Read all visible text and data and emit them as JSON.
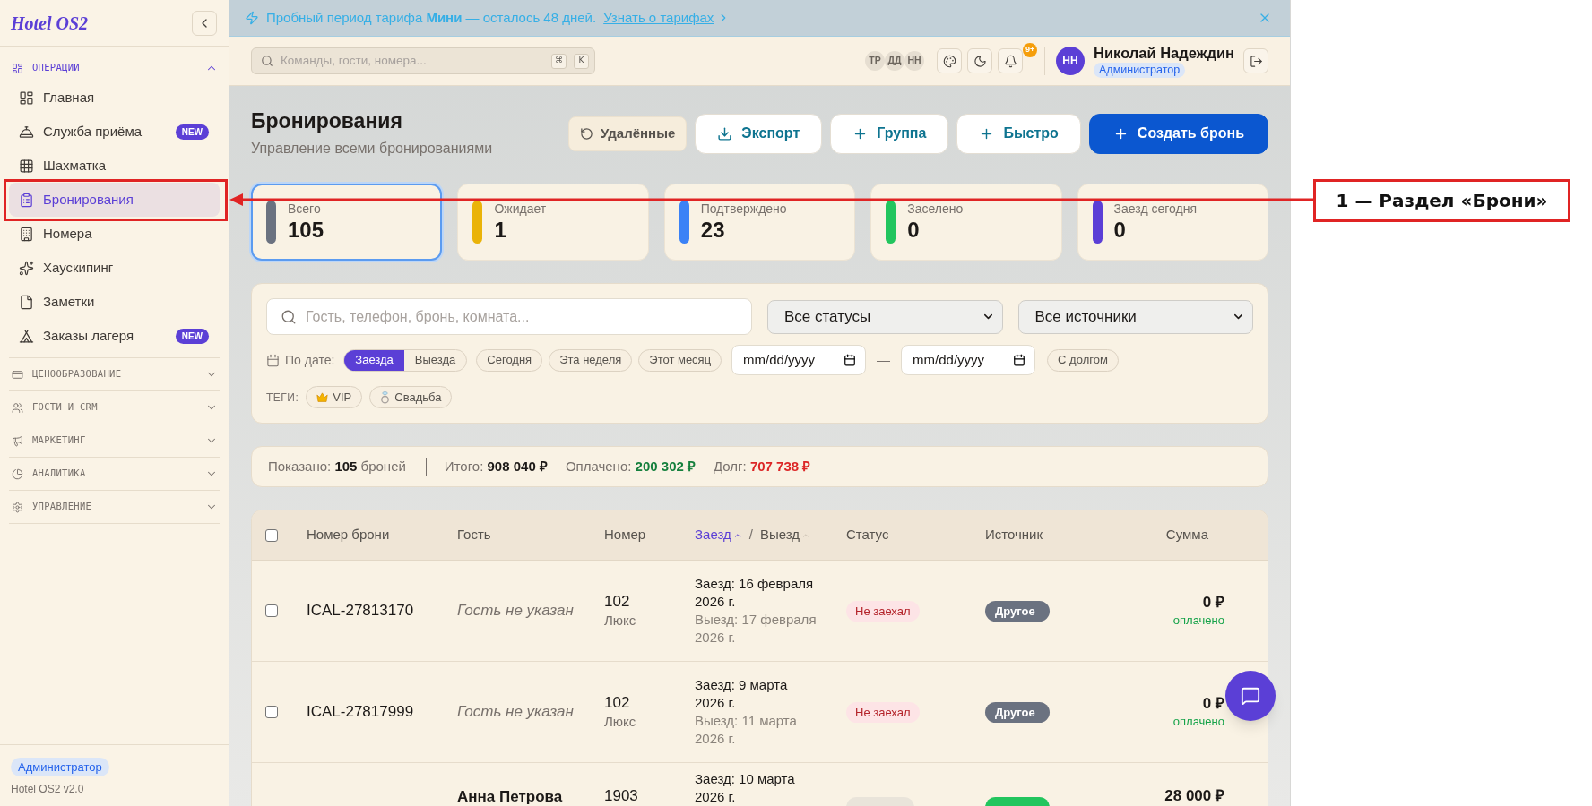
{
  "sidebar": {
    "logo": "Hotel OS2",
    "sections": [
      {
        "title": "ОПЕРАЦИИ",
        "expanded": true,
        "items": [
          {
            "label": "Главная",
            "selected": false
          },
          {
            "label": "Служба приёма",
            "selected": false,
            "badge": "NEW"
          },
          {
            "label": "Шахматка",
            "selected": false
          },
          {
            "label": "Бронирования",
            "selected": true
          },
          {
            "label": "Номера",
            "selected": false
          },
          {
            "label": "Хаускипинг",
            "selected": false
          },
          {
            "label": "Заметки",
            "selected": false
          },
          {
            "label": "Заказы лагеря",
            "selected": false,
            "badge": "NEW"
          }
        ]
      },
      {
        "title": "ЦЕНООБРАЗОВАНИЕ",
        "expanded": false
      },
      {
        "title": "ГОСТИ И CRM",
        "expanded": false
      },
      {
        "title": "МАРКЕТИНГ",
        "expanded": false
      },
      {
        "title": "АНАЛИТИКА",
        "expanded": false
      },
      {
        "title": "УПРАВЛЕНИЕ",
        "expanded": false
      }
    ],
    "footer": {
      "role": "Администратор",
      "version": "Hotel OS2 v2.0"
    }
  },
  "banner": {
    "text": "Пробный период тарифа **Мини** — осталось 48 дней.",
    "link": "Узнать о тарифах"
  },
  "topbar": {
    "search": {
      "placeholder": "Команды, гости, номера...",
      "keys": [
        "⌘",
        "K"
      ]
    },
    "presence": [
      "ТР",
      "ДД",
      "НН"
    ],
    "notifications": "9+",
    "user": {
      "initials": "НН",
      "name": "Николай Надеждин",
      "role": "Администратор"
    }
  },
  "page": {
    "title": "Бронирования",
    "subtitle": "Управление всеми бронированиями",
    "actions": [
      {
        "label": "Удалённые",
        "kind": "muted"
      },
      {
        "label": "Экспорт",
        "kind": "outline"
      },
      {
        "label": "Группа",
        "kind": "outline"
      },
      {
        "label": "Быстро",
        "kind": "outline"
      },
      {
        "label": "Создать бронь",
        "kind": "primary"
      }
    ]
  },
  "stats": [
    {
      "label": "Всего",
      "value": "105",
      "color": "#6b7280",
      "selected": true
    },
    {
      "label": "Ожидает",
      "value": "1",
      "color": "#eab308",
      "selected": false
    },
    {
      "label": "Подтверждено",
      "value": "23",
      "color": "#3b82f6",
      "selected": false
    },
    {
      "label": "Заселено",
      "value": "0",
      "color": "#22c55e",
      "selected": false
    },
    {
      "label": "Заезд сегодня",
      "value": "0",
      "color": "#5b3fd6",
      "selected": false
    }
  ],
  "filters": {
    "search": {
      "placeholder": "Гость, телефон, бронь, комната..."
    },
    "selects": [
      "Все статусы",
      "Все источники"
    ],
    "date_label": "По дате:",
    "date_modes": [
      {
        "label": "Заезда",
        "selected": true
      },
      {
        "label": "Выезда",
        "selected": false
      }
    ],
    "presets": [
      {
        "label": "Сегодня",
        "selected": false
      },
      {
        "label": "Эта неделя",
        "selected": false
      },
      {
        "label": "Этот месяц",
        "selected": false
      }
    ],
    "date_from": {
      "placeholder": "mm/dd/yyyy"
    },
    "date_separator": "—",
    "date_to": {
      "placeholder": "mm/dd/yyyy"
    },
    "debt_filter": {
      "label": "С долгом",
      "selected": false
    },
    "tags_label": "ТЕГИ:",
    "tags": [
      {
        "label": "VIP",
        "selected": false
      },
      {
        "label": "Свадьба",
        "selected": false
      }
    ]
  },
  "summary": [
    {
      "label": "Показано:",
      "value": "105",
      "suffix": "броней",
      "kind": "count"
    },
    {
      "label": "Итого:",
      "value": "908 040 ₽",
      "kind": "total"
    },
    {
      "label": "Оплачено:",
      "value": "200 302 ₽",
      "kind": "paid"
    },
    {
      "label": "Долг:",
      "value": "707 738 ₽",
      "kind": "debt"
    }
  ],
  "table": {
    "select_all": {
      "checked": false
    },
    "columns": [
      {
        "label": "Номер брони"
      },
      {
        "label": "Гость"
      },
      {
        "label": "Номер"
      },
      {
        "kind": "sort_pair",
        "parts": [
          {
            "label": "Заезд",
            "selected": true
          },
          {
            "label": "Выезд",
            "selected": false
          }
        ],
        "separator": "/"
      },
      {
        "label": "Статус"
      },
      {
        "label": "Источник"
      },
      {
        "label": "Сумма"
      }
    ],
    "rows": [
      {
        "checked": false,
        "booking": "ICAL-27813170",
        "guest": "Гость не указан",
        "guest_missing": true,
        "room": "102",
        "room_type": "Люкс",
        "check_in": "Заезд: 16 февраля 2026 г.",
        "check_out": "Выезд: 17 февраля 2026 г.",
        "status": {
          "label": "Не заехал",
          "kind": "alert"
        },
        "source": {
          "label": "Другое",
          "color": "#6b7280"
        },
        "amount": "0 ₽",
        "payment": "оплачено"
      },
      {
        "checked": false,
        "booking": "ICAL-27817999",
        "guest": "Гость не указан",
        "guest_missing": true,
        "room": "102",
        "room_type": "Люкс",
        "check_in": "Заезд: 9 марта 2026 г.",
        "check_out": "Выезд: 11 марта 2026 г.",
        "status": {
          "label": "Не заехал",
          "kind": "alert"
        },
        "source": {
          "label": "Другое",
          "color": "#6b7280"
        },
        "amount": "0 ₽",
        "payment": "оплачено"
      },
      {
        "guest": "Анна Петрова",
        "guest_missing": false,
        "room": "1903",
        "check_in": "Заезд: 10 марта 2026 г.",
        "status": {
          "kind": "neutral"
        },
        "source": {
          "color": "#22c55e"
        },
        "amount": "28 000 ₽"
      }
    ]
  },
  "annotation": {
    "label": "1 — Раздел «Брони»"
  }
}
